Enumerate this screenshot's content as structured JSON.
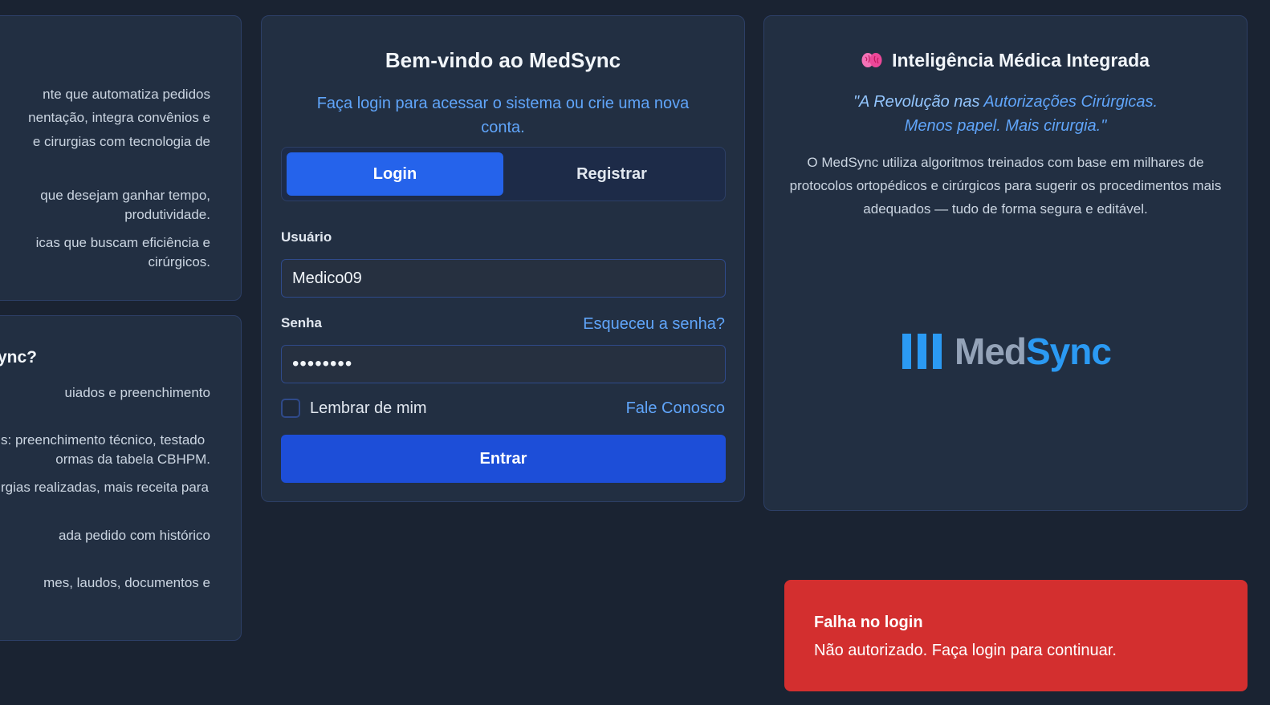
{
  "about_card": {
    "lines": [
      "nte que automatiza pedidos",
      "nentação, integra convênios e",
      "e cirurgias com tecnologia de",
      "que desejam ganhar tempo,",
      "produtividade.",
      "icas que buscam eficiência e",
      "cirúrgicos."
    ]
  },
  "why_card": {
    "title": "ync?",
    "lines": [
      "uiados e preenchimento",
      "s: preenchimento técnico, testado",
      "ormas da tabela CBHPM.",
      "rgias realizadas, mais receita para",
      "ada pedido com histórico",
      "mes, laudos, documentos e"
    ]
  },
  "login": {
    "title": "Bem-vindo ao MedSync",
    "subtitle": "Faça login para acessar o sistema ou crie uma nova conta.",
    "tabs": [
      "Login",
      "Registrar"
    ],
    "username_label": "Usuário",
    "username_value": "Medico09",
    "password_label": "Senha",
    "password_value": "12345678",
    "forgot_link": "Esqueceu a senha?",
    "remember_label": "Lembrar de mim",
    "contact_link": "Fale Conosco",
    "submit_label": "Entrar"
  },
  "ai_card": {
    "title": "Inteligência Médica Integrada",
    "title_icon": "brain-icon",
    "quote_prefix": "\"A Revolução nas ",
    "quote_highlight": "Autorizações Cirúrgicas.",
    "quote_line2": "Menos papel. Mais cirurgia.\"",
    "description": "O MedSync utiliza algoritmos treinados com base em milhares de protocolos ortopédicos e cirúrgicos para sugerir os procedimentos mais adequados — tudo de forma segura e editável.",
    "logo_med": "Med",
    "logo_sync": "Sync"
  },
  "toast": {
    "title": "Falha no login",
    "message": "Não autorizado. Faça login para continuar."
  },
  "colors": {
    "background": "#1a2332",
    "card": "#222f42",
    "accent": "#2563eb",
    "link": "#60a5fa",
    "error": "#d32f2f"
  }
}
